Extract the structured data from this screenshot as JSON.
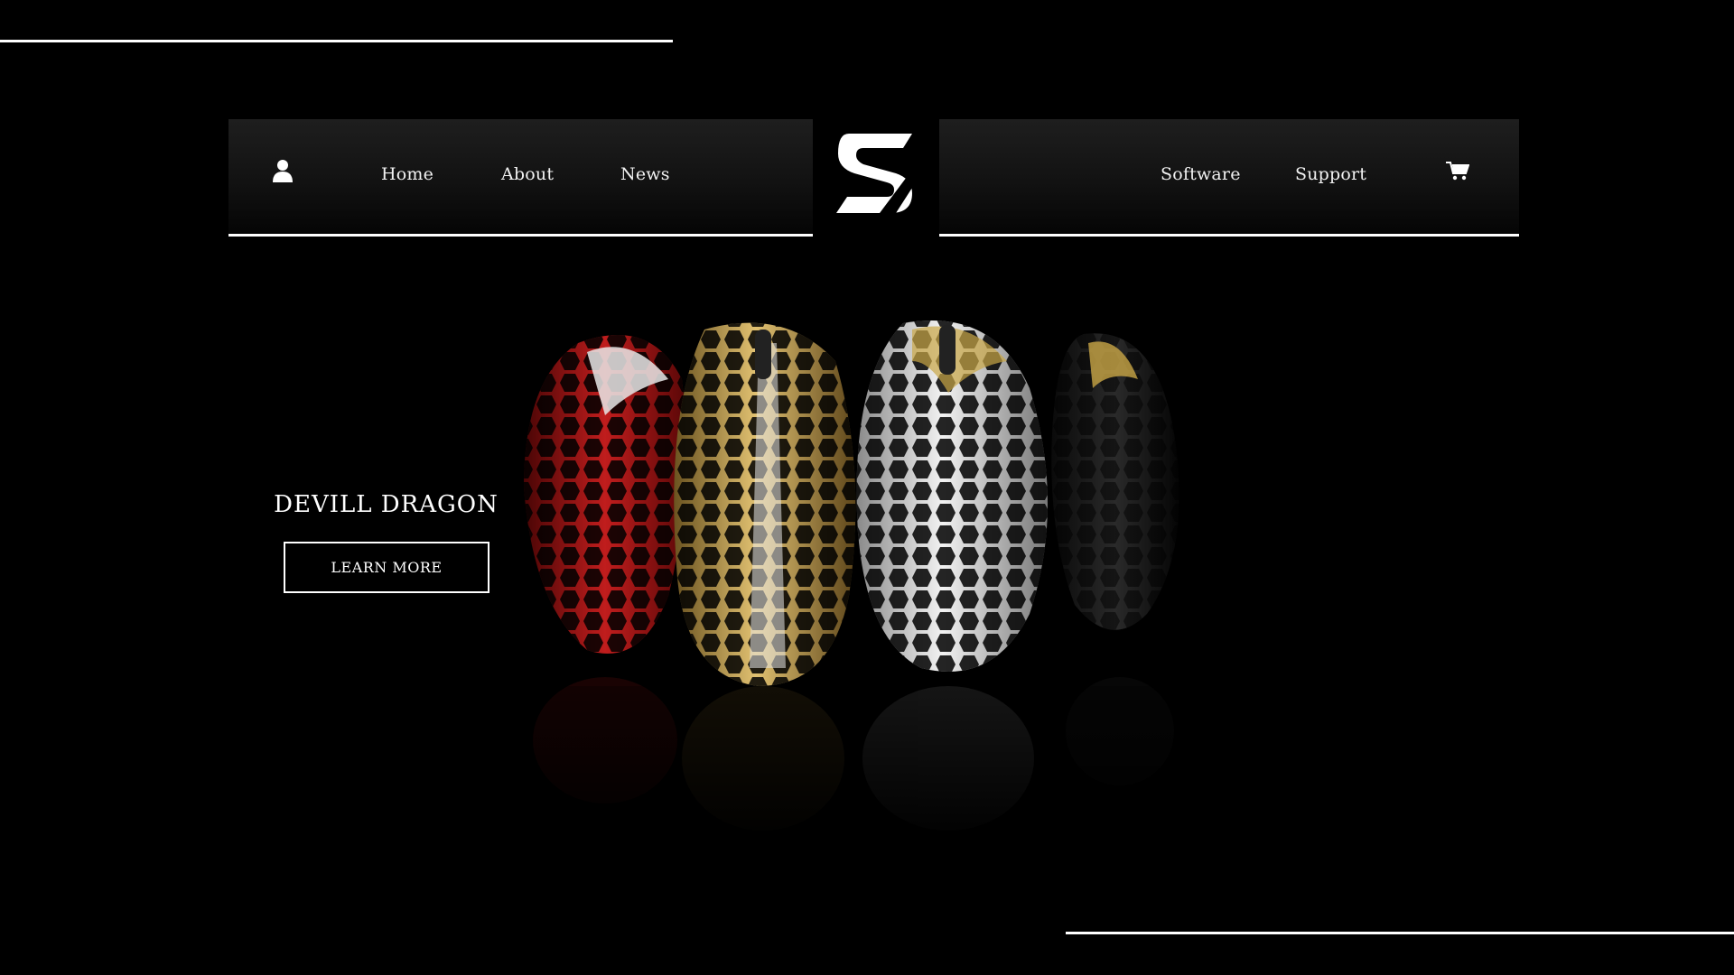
{
  "nav": {
    "left_items": [
      {
        "label": "Home"
      },
      {
        "label": "About"
      },
      {
        "label": "News"
      }
    ],
    "right_items": [
      {
        "label": "Software"
      },
      {
        "label": "Support"
      }
    ],
    "icons": {
      "account": "user-icon",
      "cart": "cart-icon",
      "logo": "brand-logo-s"
    }
  },
  "hero": {
    "title": "DEVILL DRAGON",
    "cta_label": "LEARN MORE",
    "product_colors": [
      "#b81818",
      "#c9a646",
      "#d9d9d9",
      "#151515"
    ]
  },
  "colors": {
    "background": "#000000",
    "text": "#ffffff",
    "panel": "#1a1a1a"
  }
}
